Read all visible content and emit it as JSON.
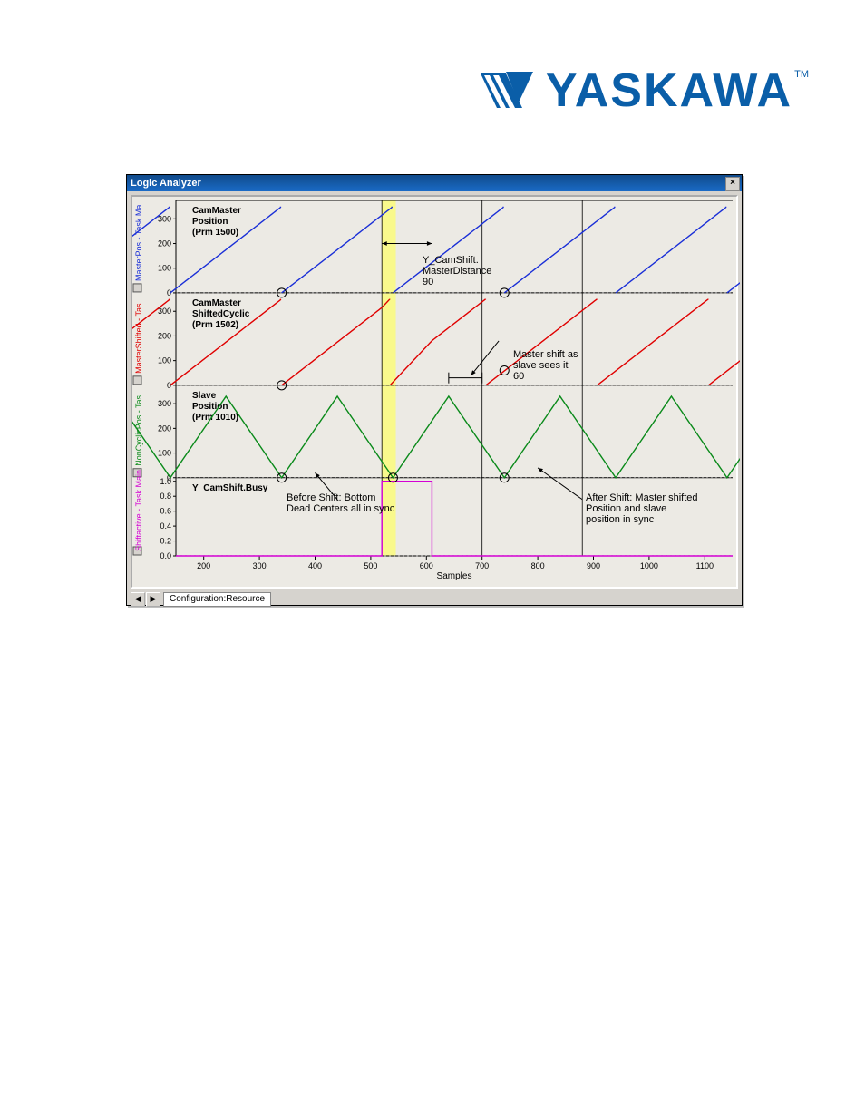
{
  "logo": {
    "text": "YASKAWA",
    "tm": "TM"
  },
  "window": {
    "title": "Logic Analyzer",
    "close_glyph": "×",
    "tab_prev": "◀",
    "tab_next": "▶",
    "tab_label": "Configuration:Resource"
  },
  "xaxis": {
    "label": "Samples",
    "ticks": [
      "200",
      "300",
      "400",
      "500",
      "600",
      "700",
      "800",
      "900",
      "1000",
      "1100"
    ]
  },
  "panes": [
    {
      "side_label": "MasterPos - Task.Ma...",
      "yticks": [
        "0",
        "100",
        "200",
        "300"
      ],
      "series_label": "CamMaster\nPosition\n(Prm 1500)",
      "color": "#1a2fd7"
    },
    {
      "side_label": "MasterShifted - Tas...",
      "yticks": [
        "0",
        "100",
        "200",
        "300"
      ],
      "series_label": "CamMaster\nShiftedCyclic\n(Prm 1502)",
      "color": "#e00000"
    },
    {
      "side_label": "NonCyclicPos - Tas...",
      "yticks": [
        "0",
        "100",
        "200",
        "300"
      ],
      "series_label": "Slave\nPosition\n(Prm 1010)",
      "color": "#0a8a1a"
    },
    {
      "side_label": "Shiftactive - Task.Main",
      "yticks": [
        "0.0",
        "0.2",
        "0.4",
        "0.6",
        "0.8",
        "1.0"
      ],
      "series_label": "Y_CamShift.Busy",
      "color": "#d400d4"
    }
  ],
  "annotations": {
    "masterdistance": "Y_CamShift.\nMasterDistance\n90",
    "mastershift": "Master shift as\nslave sees it\n60",
    "before": "Before Shift: Bottom\nDead Centers all in sync",
    "after": "After Shift: Master shifted\nPosition and slave\nposition in sync"
  },
  "chart_data": {
    "type": "line",
    "xlabel": "Samples",
    "xlim": [
      150,
      1150
    ],
    "panes": [
      {
        "name": "CamMaster Position (Prm 1500)",
        "ylabel": "MasterPos",
        "ylim": [
          0,
          360
        ],
        "type": "sawtooth",
        "period_samples": 200,
        "amplitude": 360,
        "phase_start": 140
      },
      {
        "name": "CamMaster ShiftedCyclic (Prm 1502)",
        "ylabel": "MasterShifted",
        "ylim": [
          0,
          360
        ],
        "type": "sawtooth_with_shift",
        "period_samples": 200,
        "amplitude": 360,
        "shift_after_sample": 540,
        "phase_shift_deg": 60
      },
      {
        "name": "Slave Position (Prm 1010)",
        "ylabel": "NonCyclicPos",
        "ylim": [
          0,
          360
        ],
        "type": "triangle",
        "period_samples": 200,
        "amplitude": 340
      },
      {
        "name": "Y_CamShift.Busy",
        "ylabel": "Shiftactive",
        "ylim": [
          0,
          1
        ],
        "type": "pulse",
        "pulse_start": 520,
        "pulse_end": 610,
        "high": 1.0,
        "low": 0.0
      }
    ],
    "annotations": [
      {
        "text": "Y_CamShift.MasterDistance 90",
        "x": 560,
        "pane": 0
      },
      {
        "text": "Master shift as slave sees it 60",
        "x": 650,
        "pane": 1
      },
      {
        "text": "Before Shift: Bottom Dead Centers all in sync",
        "x": 440,
        "pane": 2
      },
      {
        "text": "After Shift: Master shifted Position and slave position in sync",
        "x": 880,
        "pane": 2
      }
    ],
    "markers": {
      "yellow_band": [
        520,
        545
      ],
      "vlines": [
        520,
        610,
        700,
        880
      ]
    }
  }
}
